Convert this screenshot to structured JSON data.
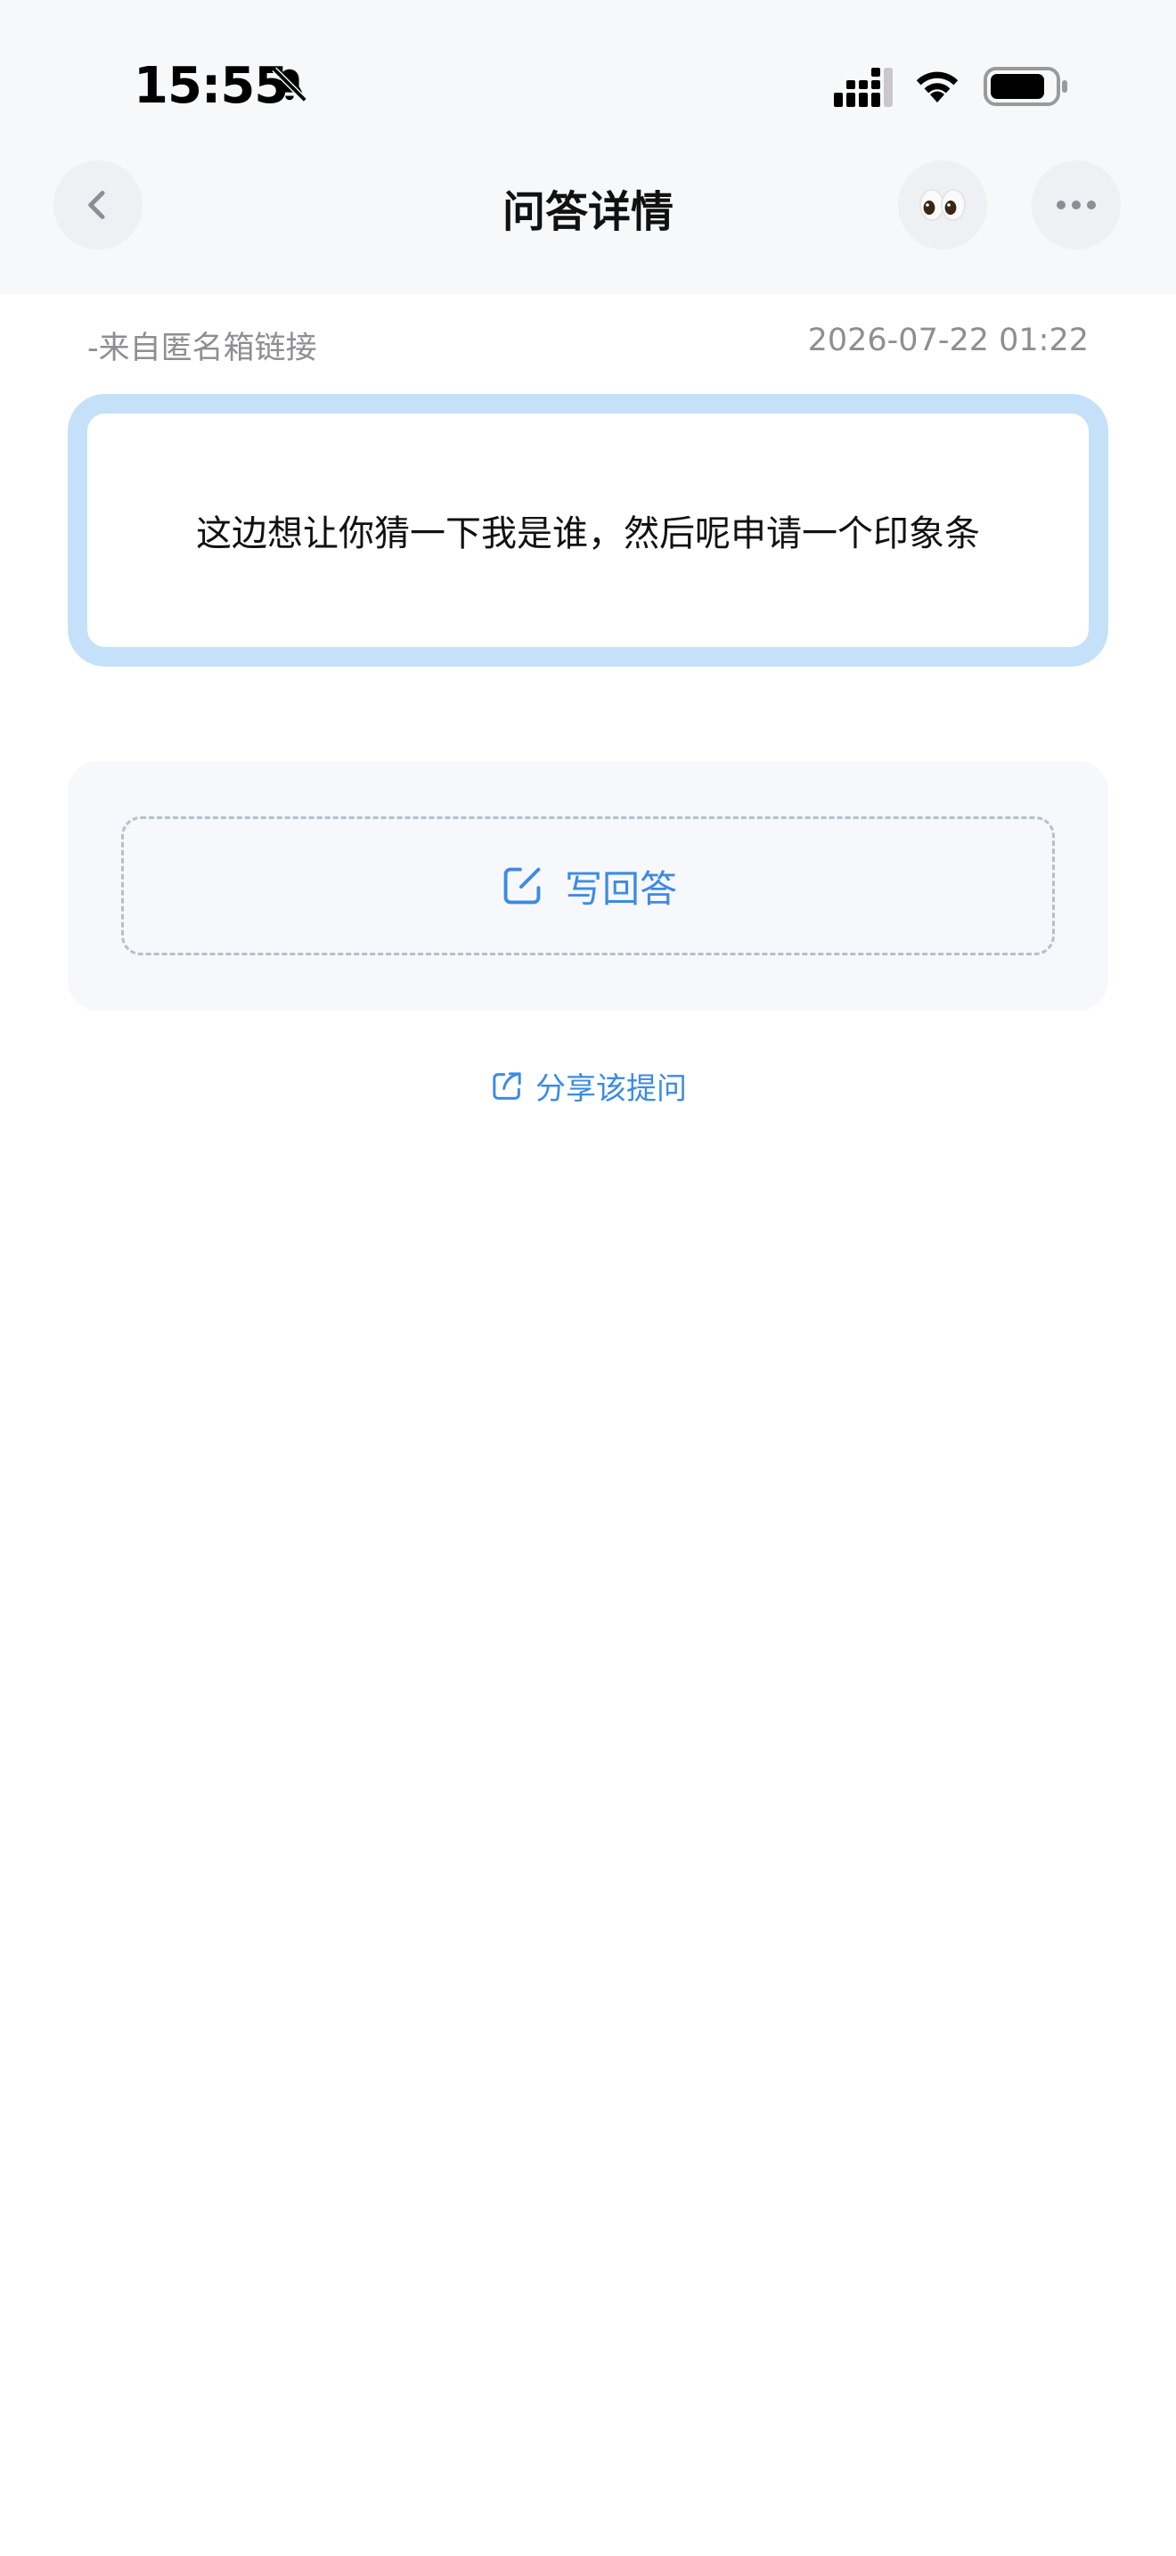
{
  "status_bar": {
    "time": "15:55"
  },
  "nav": {
    "title": "问答详情",
    "eyes_emoji": "👀"
  },
  "meta": {
    "source": "-来自匿名箱链接",
    "timestamp": "2026-07-22 01:22"
  },
  "question": {
    "text": "这边想让你猜一下我是谁，然后呢申请一个印象条"
  },
  "actions": {
    "write_answer_label": "写回答",
    "share_label": "分享该提问"
  },
  "colors": {
    "accent": "#3d8be3",
    "card_border": "#c5e1fa",
    "header_bg": "#f7f8f9",
    "meta_text": "#8e8e93"
  },
  "icons": [
    "back-chevron-icon",
    "eyes-icon",
    "more-dots-icon",
    "edit-icon",
    "share-icon",
    "bell-off-icon",
    "signal-icon",
    "wifi-icon",
    "battery-icon"
  ]
}
